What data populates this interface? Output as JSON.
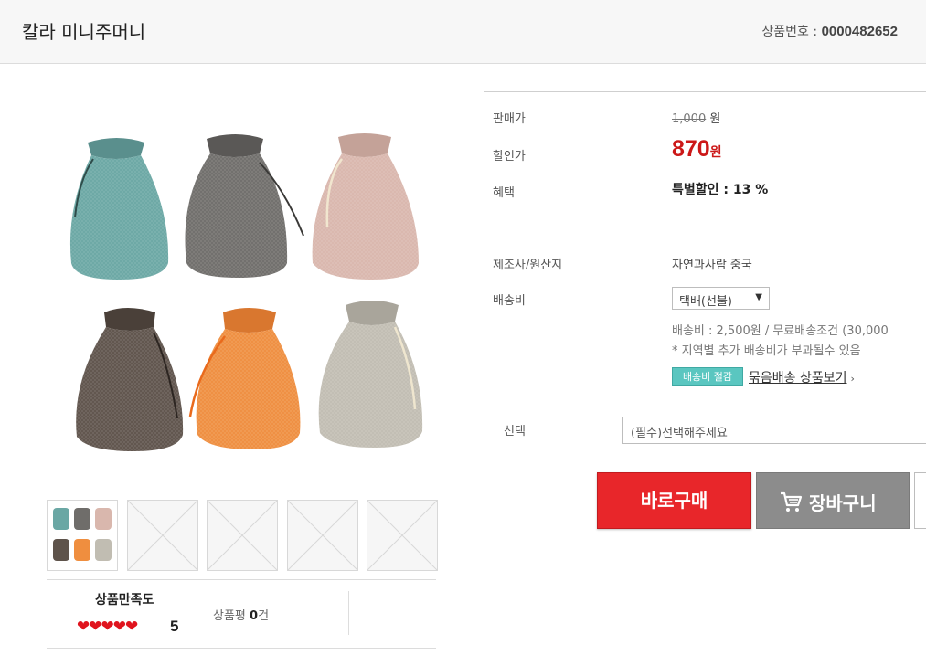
{
  "header": {
    "title": "칼라 미니주머니",
    "product_no_label": "상품번호 :",
    "product_no": "0000482652"
  },
  "price_block": {
    "sale_label": "판매가",
    "sale_price": "1,000",
    "sale_unit": "원",
    "discount_label": "할인가",
    "discount_price": "870",
    "discount_unit": "원",
    "benefit_label": "혜택",
    "benefit_text": "특별할인 : 13 %"
  },
  "shipping_block": {
    "maker_label": "제조사/원산지",
    "maker_value": "자연과사람 중국",
    "ship_label": "배송비",
    "ship_method": "택배(선불)",
    "ship_fee_text": "배송비 : 2,500원 / 무료배송조건 (30,000",
    "ship_note": "* 지역별 추가 배송비가 부과될수 있음",
    "badge": "배송비 절감",
    "bundle_link": "묶음배송 상품보기",
    "bundle_chevron": "›"
  },
  "options": {
    "select_label": "선택",
    "select_value": "(필수)선택해주세요"
  },
  "buttons": {
    "buy": "바로구매",
    "cart": "장바구니"
  },
  "rating": {
    "label": "상품만족도",
    "hearts": "❤❤❤❤❤",
    "score": "5",
    "review_label": "상품평",
    "review_count": "0",
    "review_unit": "건"
  },
  "colors": {
    "buy_red": "#e8262a",
    "price_red": "#cc1818",
    "cart_gray": "#8c8c8c",
    "badge_teal": "#5ac6c0"
  },
  "thumbnails": [
    "product-photo",
    "placeholder",
    "placeholder",
    "placeholder",
    "placeholder"
  ]
}
